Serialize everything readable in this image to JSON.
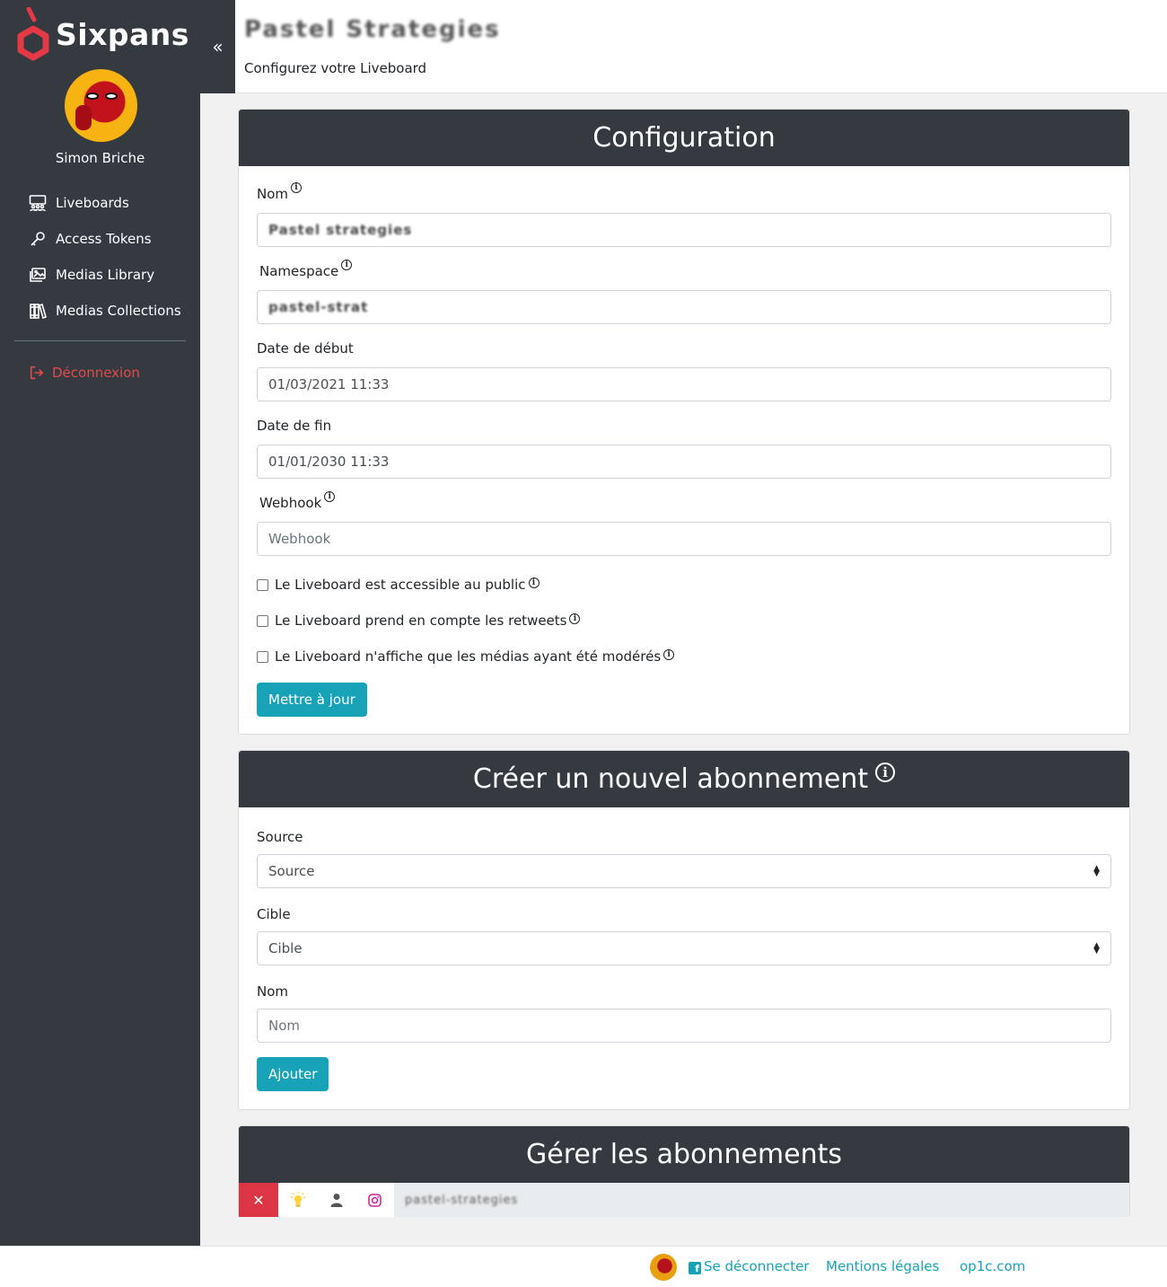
{
  "app": {
    "brand": "Sixpans"
  },
  "sidebar": {
    "user_name": "Simon Briche",
    "items": [
      {
        "label": "Liveboards",
        "icon": "liveboards-icon"
      },
      {
        "label": "Access Tokens",
        "icon": "key-icon"
      },
      {
        "label": "Medias Library",
        "icon": "images-icon"
      },
      {
        "label": "Medias Collections",
        "icon": "books-icon"
      }
    ],
    "logout_label": "Déconnexion"
  },
  "header": {
    "title": "Pastel Strategies",
    "subtitle": "Configurez votre Liveboard"
  },
  "config": {
    "title": "Configuration",
    "nom_label": "Nom",
    "nom_value": "Pastel strategies",
    "namespace_label": "Namespace",
    "namespace_value": "pastel-strat",
    "date_debut_label": "Date de début",
    "date_debut_value": "01/03/2021 11:33",
    "date_fin_label": "Date de fin",
    "date_fin_value": "01/01/2030 11:33",
    "webhook_label": "Webhook",
    "webhook_placeholder": "Webhook",
    "check_public": "Le Liveboard est accessible au public",
    "check_retweets": "Le Liveboard prend en compte les retweets",
    "check_moderated": "Le Liveboard n'affiche que les médias ayant été modérés",
    "submit_label": "Mettre à jour"
  },
  "subscription_new": {
    "title": "Créer un nouvel abonnement",
    "source_label": "Source",
    "source_value": "Source",
    "cible_label": "Cible",
    "cible_value": "Cible",
    "nom_label": "Nom",
    "nom_placeholder": "Nom",
    "submit_label": "Ajouter"
  },
  "subscriptions_manage": {
    "title": "Gérer les abonnements",
    "rows": [
      {
        "name": "pastel-strategies",
        "icons": [
          "close-icon",
          "lightbulb-icon",
          "user-icon",
          "instagram-icon"
        ]
      }
    ]
  },
  "footer": {
    "logout_label": "Se déconnecter",
    "legal_label": "Mentions légales",
    "site_label": "op1c.com"
  },
  "colors": {
    "accent": "#17a2b8",
    "dark": "#343a40",
    "danger": "#dc3545"
  }
}
